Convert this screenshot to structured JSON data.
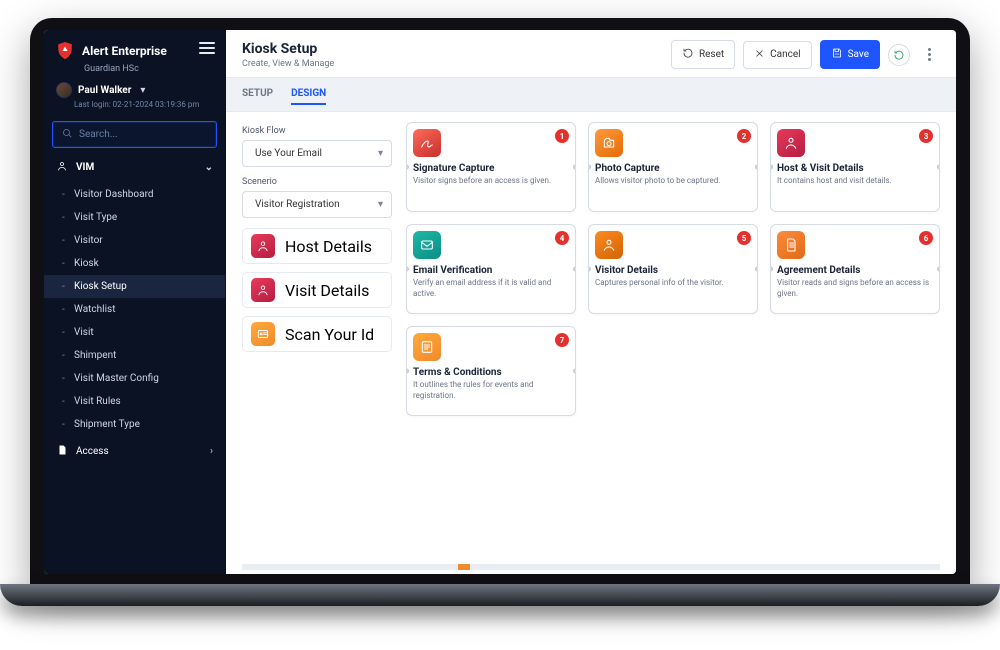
{
  "brand": {
    "name": "Alert Enterprise",
    "sub": "Guardian HSc"
  },
  "user": {
    "name": "Paul Walker",
    "last_login": "Last login: 02-21-2024 03:19:36 pm"
  },
  "search": {
    "placeholder": "Search..."
  },
  "sidebar": {
    "group_label": "VIM",
    "items": [
      {
        "label": "Visitor Dashboard"
      },
      {
        "label": "Visit Type"
      },
      {
        "label": "Visitor"
      },
      {
        "label": "Kiosk"
      },
      {
        "label": "Kiosk Setup",
        "active": true
      },
      {
        "label": "Watchlist"
      },
      {
        "label": "Visit"
      },
      {
        "label": "Shimpent"
      },
      {
        "label": "Visit Master Config"
      },
      {
        "label": "Visit Rules"
      },
      {
        "label": "Shipment Type"
      }
    ],
    "access_label": "Access"
  },
  "header": {
    "title": "Kiosk Setup",
    "subtitle": "Create, View & Manage",
    "reset": "Reset",
    "cancel": "Cancel",
    "save": "Save"
  },
  "tabs": {
    "setup": "SETUP",
    "design": "DESIGN"
  },
  "config": {
    "flow_label": "Kiosk Flow",
    "flow_value": "Use Your Email",
    "scenario_label": "Scenerio",
    "scenario_value": "Visitor Registration",
    "actions": [
      {
        "label": "Host Details"
      },
      {
        "label": "Visit Details"
      },
      {
        "label": "Scan Your Id"
      }
    ]
  },
  "cards": [
    {
      "n": "1",
      "title": "Signature Capture",
      "desc": "Visitor signs before an access is given."
    },
    {
      "n": "2",
      "title": "Photo Capture",
      "desc": "Allows visitor photo to be captured."
    },
    {
      "n": "3",
      "title": "Host & Visit Details",
      "desc": "It contains host and visit details."
    },
    {
      "n": "4",
      "title": "Email Verification",
      "desc": "Verify an email address if it is valid and active."
    },
    {
      "n": "5",
      "title": "Visitor Details",
      "desc": "Captures personal info of the visitor."
    },
    {
      "n": "6",
      "title": "Agreement Details",
      "desc": "Visitor reads and signs before an access is given."
    },
    {
      "n": "7",
      "title": "Terms & Conditions",
      "desc": "It outlines the rules for events and registration."
    }
  ]
}
